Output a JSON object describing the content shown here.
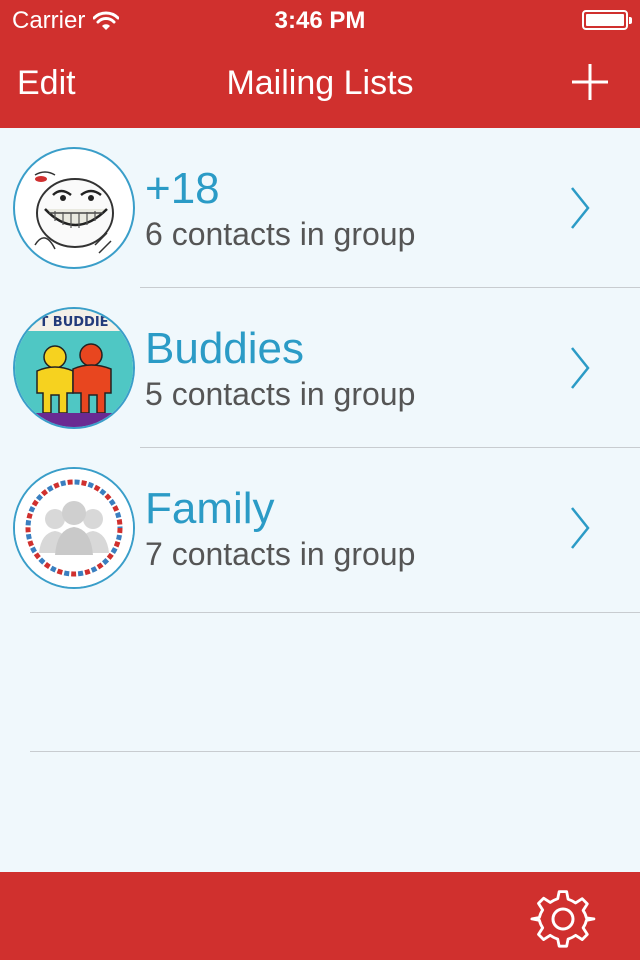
{
  "status_bar": {
    "carrier": "Carrier",
    "time": "3:46 PM"
  },
  "nav": {
    "edit_label": "Edit",
    "title": "Mailing Lists",
    "add_icon": "plus-icon"
  },
  "groups": [
    {
      "name": "+18",
      "subtitle": "6 contacts in group",
      "avatar": "troll-face-avatar"
    },
    {
      "name": "Buddies",
      "subtitle": "5 contacts in group",
      "avatar": "buddies-avatar",
      "avatar_text": "T BUDDIE"
    },
    {
      "name": "Family",
      "subtitle": "7 contacts in group",
      "avatar": "family-group-avatar"
    }
  ],
  "toolbar": {
    "settings_icon": "gear-icon"
  },
  "colors": {
    "brand_red": "#d0302e",
    "accent_blue": "#2b9bc6",
    "background": "#f0f8fc"
  }
}
